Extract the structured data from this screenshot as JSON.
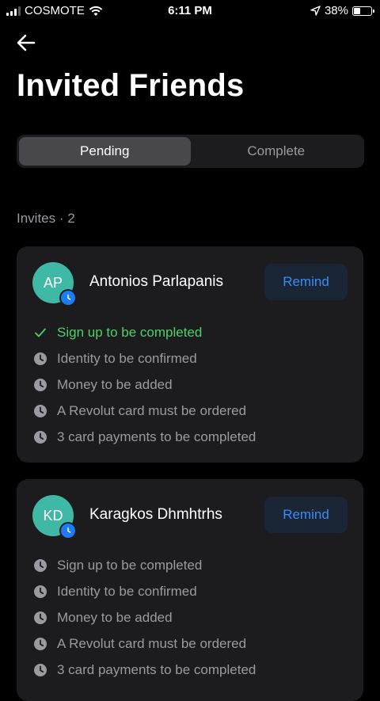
{
  "status_bar": {
    "carrier": "COSMOTE",
    "time": "6:11 PM",
    "battery": "38%",
    "battery_level": 0.38
  },
  "header": {
    "back_icon": "arrow-left-icon",
    "title": "Invited Friends"
  },
  "tabs": [
    {
      "label": "Pending",
      "active": true
    },
    {
      "label": "Complete",
      "active": false
    }
  ],
  "section": {
    "label": "Invites · 2"
  },
  "colors": {
    "accent": "#3b8cf5",
    "avatar": "#3fb8a6",
    "done": "#4fcf6a",
    "card": "#1c1c1e"
  },
  "invites": [
    {
      "initials": "AP",
      "name": "Antonios Parlapanis",
      "button": "Remind",
      "steps": [
        {
          "label": "Sign up to be completed",
          "status": "done",
          "icon": "check-icon"
        },
        {
          "label": "Identity to be confirmed",
          "status": "pending",
          "icon": "clock-icon"
        },
        {
          "label": "Money to be added",
          "status": "pending",
          "icon": "clock-icon"
        },
        {
          "label": "A Revolut card must be ordered",
          "status": "pending",
          "icon": "clock-icon"
        },
        {
          "label": "3 card payments to be completed",
          "status": "pending",
          "icon": "clock-icon"
        }
      ]
    },
    {
      "initials": "KD",
      "name": "Karagkos Dhmhtrhs",
      "button": "Remind",
      "steps": [
        {
          "label": "Sign up to be completed",
          "status": "pending",
          "icon": "clock-icon"
        },
        {
          "label": "Identity to be confirmed",
          "status": "pending",
          "icon": "clock-icon"
        },
        {
          "label": "Money to be added",
          "status": "pending",
          "icon": "clock-icon"
        },
        {
          "label": "A Revolut card must be ordered",
          "status": "pending",
          "icon": "clock-icon"
        },
        {
          "label": "3 card payments to be completed",
          "status": "pending",
          "icon": "clock-icon"
        }
      ]
    }
  ]
}
